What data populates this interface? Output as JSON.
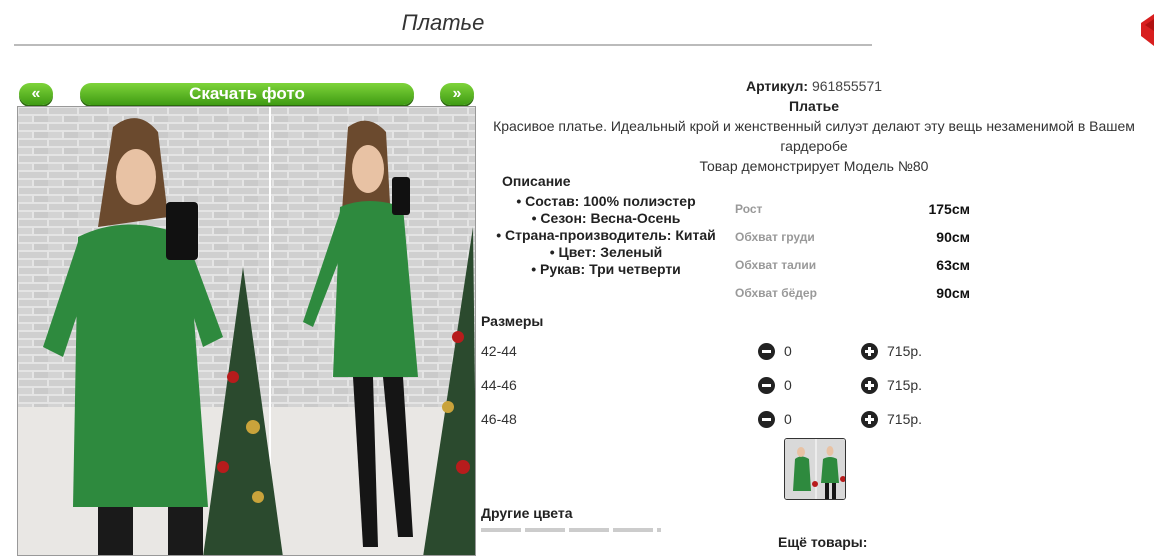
{
  "page": {
    "title": "Платье"
  },
  "gallery": {
    "prev_label": "«",
    "next_label": "»",
    "download_label": "Скачать фото"
  },
  "product": {
    "article_label": "Артикул:",
    "article_value": "961855571",
    "name": "Платье",
    "description": "Красивое платье. Идеальный крой и женственный силуэт делают эту вещь незаменимой в Вашем гардеробе",
    "model_note": "Товар демонстрирует Модель №80"
  },
  "details": {
    "heading": "Описание",
    "items": [
      "Состав: 100% полиэстер",
      "Сезон: Весна-Осень",
      "Страна-производитель: Китай",
      "Цвет: Зеленый",
      "Рукав: Три четверти"
    ]
  },
  "measurements": [
    {
      "label": "Рост",
      "value": "175см"
    },
    {
      "label": "Обхват груди",
      "value": "90см"
    },
    {
      "label": "Обхват талии",
      "value": "63см"
    },
    {
      "label": "Обхват бёдер",
      "value": "90см"
    }
  ],
  "sizes": {
    "heading": "Размеры",
    "rows": [
      {
        "label": "42-44",
        "qty": "0",
        "price": "715р."
      },
      {
        "label": "44-46",
        "qty": "0",
        "price": "715р."
      },
      {
        "label": "46-48",
        "qty": "0",
        "price": "715р."
      }
    ]
  },
  "other_colors_heading": "Другие цвета",
  "more_items_heading": "Ещё товары:",
  "colors": {
    "accent_green": "#4aa81c",
    "dress_green": "#2e8a3e",
    "corner_red": "#d81e1e"
  },
  "icons": {
    "minus": "minus-circle-icon",
    "plus": "plus-circle-icon"
  }
}
